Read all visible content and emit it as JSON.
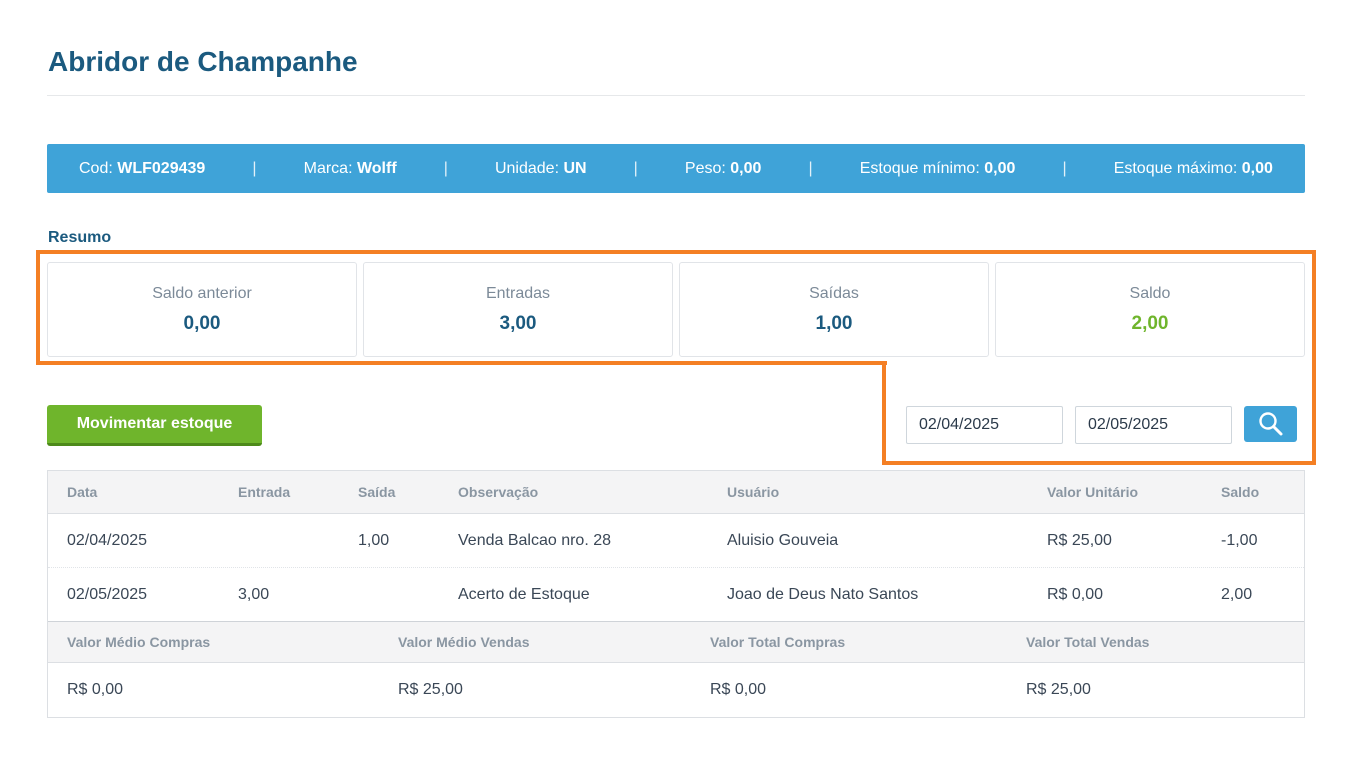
{
  "title": "Abridor de Champanhe",
  "info": {
    "cod_label": "Cod:",
    "cod_value": "WLF029439",
    "marca_label": "Marca:",
    "marca_value": "Wolff",
    "unidade_label": "Unidade:",
    "unidade_value": "UN",
    "peso_label": "Peso:",
    "peso_value": "0,00",
    "est_min_label": "Estoque mínimo:",
    "est_min_value": "0,00",
    "est_max_label": "Estoque máximo:",
    "est_max_value": "0,00",
    "separator": "|"
  },
  "resumo": {
    "label": "Resumo",
    "cards": [
      {
        "label": "Saldo anterior",
        "value": "0,00"
      },
      {
        "label": "Entradas",
        "value": "3,00"
      },
      {
        "label": "Saídas",
        "value": "1,00"
      },
      {
        "label": "Saldo",
        "value": "2,00"
      }
    ]
  },
  "actions": {
    "move_button": "Movimentar estoque",
    "date_from": "02/04/2025",
    "date_to": "02/05/2025",
    "search_icon": "search-icon"
  },
  "table": {
    "headers": [
      "Data",
      "Entrada",
      "Saída",
      "Observação",
      "Usuário",
      "Valor Unitário",
      "Saldo"
    ],
    "rows": [
      [
        "02/04/2025",
        "",
        "1,00",
        "Venda Balcao nro. 28",
        "Aluisio Gouveia",
        "R$ 25,00",
        "-1,00"
      ],
      [
        "02/05/2025",
        "3,00",
        "",
        "Acerto de Estoque",
        "Joao de Deus Nato Santos",
        "R$ 0,00",
        "2,00"
      ]
    ]
  },
  "totals": {
    "headers": [
      "Valor Médio Compras",
      "Valor Médio Vendas",
      "Valor Total Compras",
      "Valor Total Vendas"
    ],
    "values": [
      "R$ 0,00",
      "R$ 25,00",
      "R$ 0,00",
      "R$ 25,00"
    ]
  },
  "colors": {
    "title": "#1b5a7f",
    "info_bar": "#3fa3d8",
    "move_button": "#6fb52c",
    "saldo_value": "#6fb52c",
    "highlight": "#f47f24"
  }
}
